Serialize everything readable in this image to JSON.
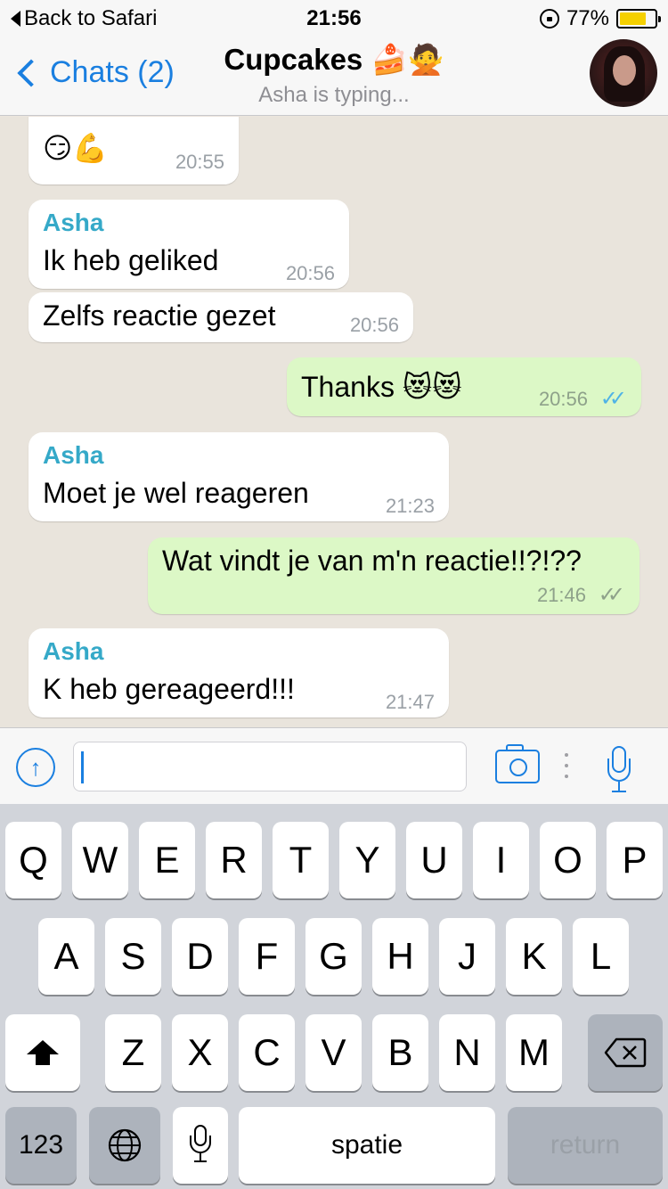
{
  "status_bar": {
    "back_label": "Back to Safari",
    "time": "21:56",
    "battery": "77%",
    "battery_level": 0.77
  },
  "nav": {
    "back_label": "Chats (2)",
    "title": "Cupcakes 🍰🙅",
    "subtitle": "Asha is typing..."
  },
  "messages": [
    {
      "direction": "in",
      "sender": "",
      "text": "😏💪",
      "time": "20:55"
    },
    {
      "direction": "in",
      "sender": "Asha",
      "text": "Ik heb geliked",
      "time": "20:56"
    },
    {
      "direction": "in",
      "sender": "",
      "text": "Zelfs reactie gezet",
      "time": "20:56"
    },
    {
      "direction": "out",
      "sender": "",
      "text": "Thanks 😻😻",
      "time": "20:56",
      "ticks": "✓✓",
      "read": true
    },
    {
      "direction": "in",
      "sender": "Asha",
      "text": "Moet je wel reageren",
      "time": "21:23"
    },
    {
      "direction": "out",
      "sender": "",
      "text": "Wat vindt je van m'n reactie!!?!??",
      "time": "21:46",
      "ticks": "✓✓",
      "read": false
    },
    {
      "direction": "in",
      "sender": "Asha",
      "text": "K heb gereageerd!!!",
      "time": "21:47"
    }
  ],
  "input": {
    "value": "",
    "placeholder": ""
  },
  "keyboard": {
    "row1": [
      "Q",
      "W",
      "E",
      "R",
      "T",
      "Y",
      "U",
      "I",
      "O",
      "P"
    ],
    "row2": [
      "A",
      "S",
      "D",
      "F",
      "G",
      "H",
      "J",
      "K",
      "L"
    ],
    "row3": [
      "Z",
      "X",
      "C",
      "V",
      "B",
      "N",
      "M"
    ],
    "numbers_label": "123",
    "space_label": "spatie",
    "return_label": "return"
  },
  "colors": {
    "accent": "#1a7fe0",
    "sender_name": "#35a9c8",
    "outgoing_bubble": "#dcf8c6",
    "incoming_bubble": "#ffffff",
    "read_ticks": "#4fb3e6",
    "unread_ticks": "#8ea18a"
  },
  "icons": [
    "back-triangle-icon",
    "rotation-lock-icon",
    "battery-icon",
    "chevron-left-icon",
    "upload-icon",
    "camera-icon",
    "more-dots-icon",
    "microphone-icon",
    "shift-icon",
    "backspace-icon",
    "globe-icon",
    "dictation-icon"
  ]
}
